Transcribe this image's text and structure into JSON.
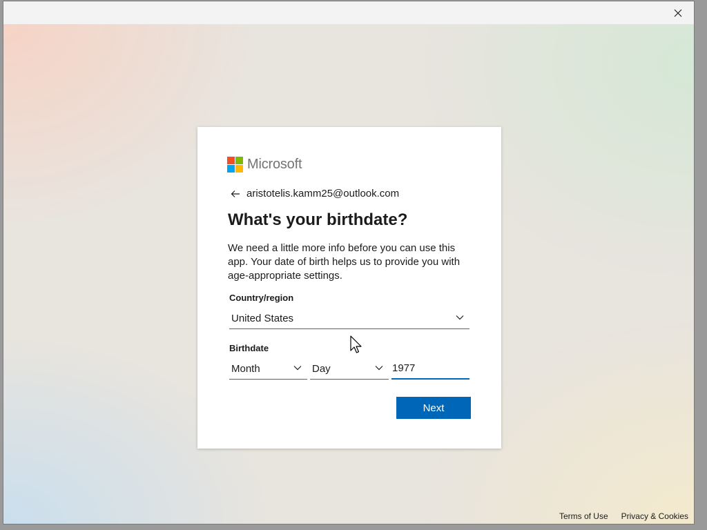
{
  "brand": {
    "name": "Microsoft",
    "colors": {
      "red": "#f25022",
      "green": "#7fba00",
      "blue": "#00a4ef",
      "yellow": "#ffb900"
    }
  },
  "identity": {
    "email": "aristotelis.kamm25@outlook.com",
    "back_icon": "left-arrow-icon"
  },
  "heading": "What's your birthdate?",
  "description": "We need a little more info before you can use this app. Your date of birth helps us to provide you with age-appropriate settings.",
  "country": {
    "label": "Country/region",
    "value": "United States"
  },
  "birthdate": {
    "label": "Birthdate",
    "month": "Month",
    "day": "Day",
    "year": "1977"
  },
  "next_label": "Next",
  "accent_color": "#0067b8",
  "footer": {
    "terms": "Terms of Use",
    "privacy": "Privacy & Cookies"
  }
}
